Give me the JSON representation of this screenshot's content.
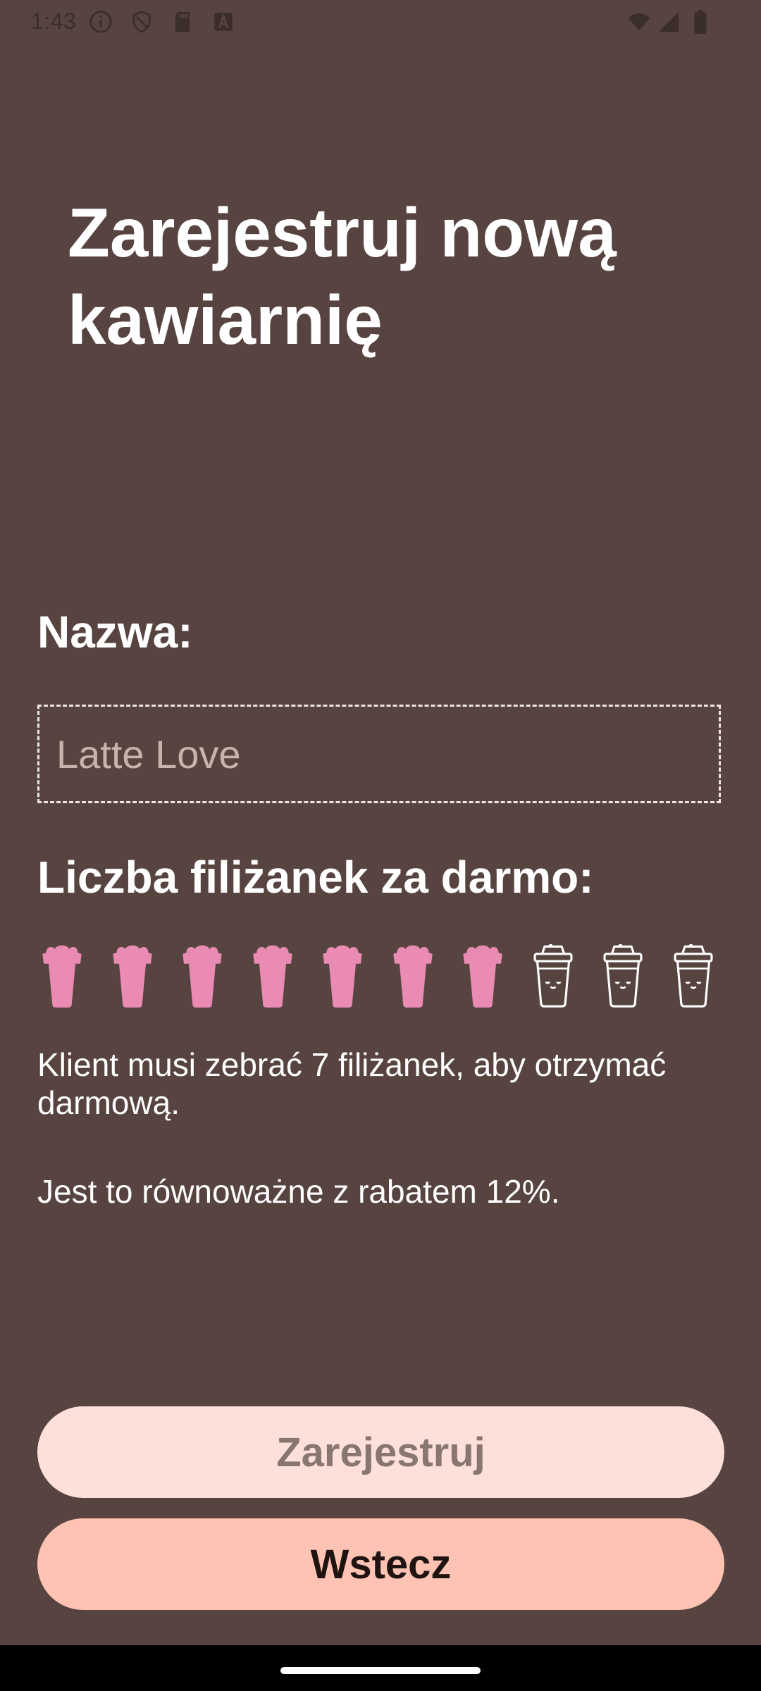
{
  "status_bar": {
    "time": "1:43",
    "left_icons": [
      "info-icon",
      "shield-icon",
      "sd-card-icon",
      "keyboard-a-icon"
    ],
    "right_icons": [
      "wifi-icon",
      "signal-icon",
      "battery-icon"
    ]
  },
  "title": "Zarejestruj nową kawiarnię",
  "form": {
    "name_label": "Nazwa:",
    "name_placeholder": "Latte Love",
    "name_value": "",
    "cups_label": "Liczba filiżanek za darmo:",
    "cups_total": 10,
    "cups_selected": 7,
    "cup_colors": {
      "filled": "#e98bb3",
      "empty_outline": "#ffffff"
    },
    "info_cups": "Klient musi zebrać 7 filiżanek, aby otrzymać darmową.",
    "info_discount": "Jest to równoważne z rabatem 12%."
  },
  "buttons": {
    "register": "Zarejestruj",
    "back": "Wstecz"
  },
  "colors": {
    "background": "#574440",
    "register_button": "#fde0d9",
    "back_button": "#fec3b2"
  }
}
